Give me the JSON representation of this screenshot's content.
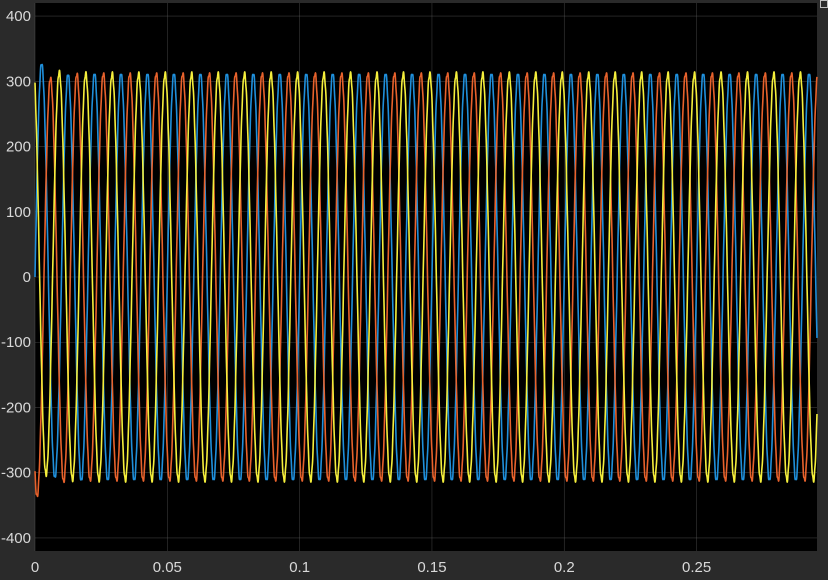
{
  "chart_data": {
    "type": "line",
    "title": "",
    "xlabel": "",
    "ylabel": "",
    "xlim": [
      0,
      0.2955
    ],
    "ylim": [
      -420,
      420
    ],
    "xticks": [
      0,
      0.05,
      0.1,
      0.15,
      0.2,
      0.25
    ],
    "xtick_labels": [
      "0",
      "0.05",
      "0.1",
      "0.15",
      "0.2",
      "0.25"
    ],
    "yticks": [
      -400,
      -300,
      -200,
      -100,
      0,
      100,
      200,
      300,
      400
    ],
    "ytick_labels": [
      "-400",
      "-300",
      "-200",
      "-100",
      "0",
      "100",
      "200",
      "300",
      "400"
    ],
    "grid": true,
    "legend": "none",
    "background_color": "#000000",
    "frame_color": "#2a2a2a",
    "series": [
      {
        "color": "#1f8fdb",
        "amplitude": 312,
        "frequency_hz": 100,
        "phase_deg": 0,
        "initial_overshoot_peak": 348
      },
      {
        "color": "#e8622c",
        "amplitude": 312,
        "frequency_hz": 100,
        "phase_deg": -120,
        "initial_overshoot_trough": -325
      },
      {
        "color": "#f5ef3c",
        "amplitude": 312,
        "frequency_hz": 100,
        "phase_deg": 120,
        "initial_overshoot_peak": 335
      }
    ]
  }
}
